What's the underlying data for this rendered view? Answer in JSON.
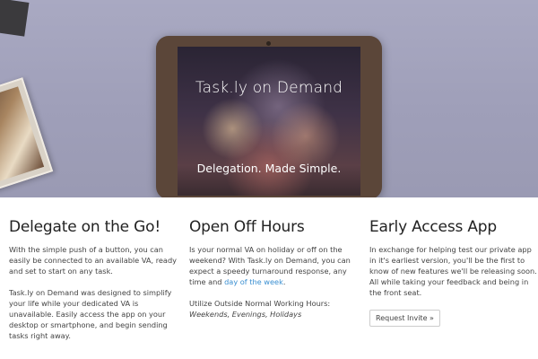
{
  "hero": {
    "screen_title": "Task.ly on Demand",
    "tagline": "Delegation. Made Simple."
  },
  "columns": [
    {
      "heading": "Delegate on the Go!",
      "p1": "With the simple push of a button, you can easily be connected to an available VA, ready and set to start on any task.",
      "p2": "Task.ly on Demand was designed to simplify your life while your dedicated VA is unavailable. Easily access the app on your desktop or smartphone, and begin sending tasks right away."
    },
    {
      "heading": "Open Off Hours",
      "p1_before_link": "Is your normal VA on holiday or off on the weekend? With Task.ly on Demand, you can expect a speedy turnaround response, any time and ",
      "p1_link": "day of the week",
      "p1_after_link": ".",
      "p2_plain": "Utilize Outside Normal Working Hours: ",
      "p2_italic": "Weekends, Evenings, Holidays"
    },
    {
      "heading": "Early Access App",
      "p1": "In exchange for helping test our private app in it's earliest version, you'll be the first to know of new features we'll be releasing soon. All while taking your feedback and being in the front seat.",
      "button": "Request Invite »"
    }
  ]
}
